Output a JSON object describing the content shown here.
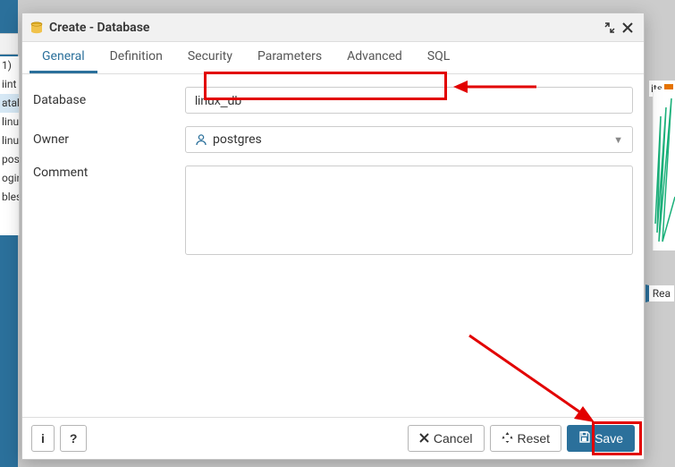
{
  "bg": {
    "sidebar": [
      "1)",
      "iint",
      "ataba",
      "linu",
      "linu",
      "pos",
      "ogin/",
      "bles"
    ],
    "its": "its",
    "rea": "Rea"
  },
  "dialog": {
    "title": "Create - Database",
    "tabs": [
      "General",
      "Definition",
      "Security",
      "Parameters",
      "Advanced",
      "SQL"
    ],
    "activeTab": 0,
    "fields": {
      "database_label": "Database",
      "database_value": "linux_db",
      "owner_label": "Owner",
      "owner_value": "postgres",
      "comment_label": "Comment",
      "comment_value": ""
    },
    "footer": {
      "info": "i",
      "help": "?",
      "cancel": "Cancel",
      "reset": "Reset",
      "save": "Save"
    }
  }
}
